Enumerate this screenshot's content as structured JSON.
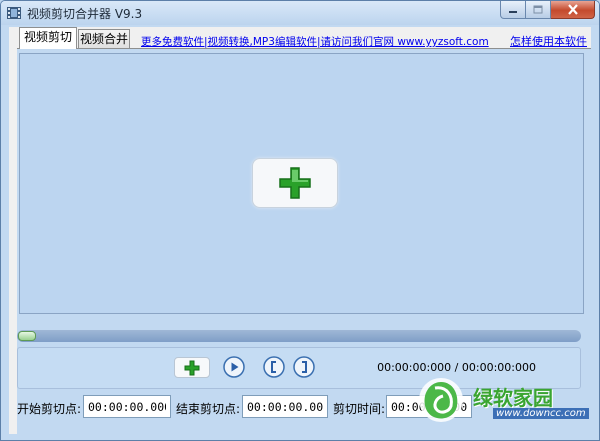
{
  "window": {
    "title": "视频剪切合并器 V9.3"
  },
  "tabs": [
    {
      "label": "视频剪切",
      "active": true
    },
    {
      "label": "视频合并",
      "active": false
    }
  ],
  "links": {
    "more": "更多免费软件|视频转换,MP3编辑软件|请访问我们官网 www.yyzsoft.com",
    "howto": "怎样使用本软件"
  },
  "player": {
    "progress": 0.0,
    "time_readout": "00:00:00:000 / 00:00:00:000"
  },
  "cut_fields": {
    "start_label": "开始剪切点:",
    "start_value": "00:00:00.000",
    "end_label": "结束剪切点:",
    "end_value": "00:00:00.000",
    "duration_label": "剪切时间:",
    "duration_value": "00:00:00.000"
  },
  "watermark": {
    "text": "绿软家园",
    "sub": "www.downcc.com"
  },
  "colors": {
    "accent_green": "#2e9b2e",
    "link_blue": "#0000ee",
    "panel_blue": "#c2d9f1"
  },
  "icons": {
    "add": "plus-icon",
    "play": "play-icon",
    "mark_in": "bracket-left-icon",
    "mark_out": "bracket-right-icon"
  }
}
